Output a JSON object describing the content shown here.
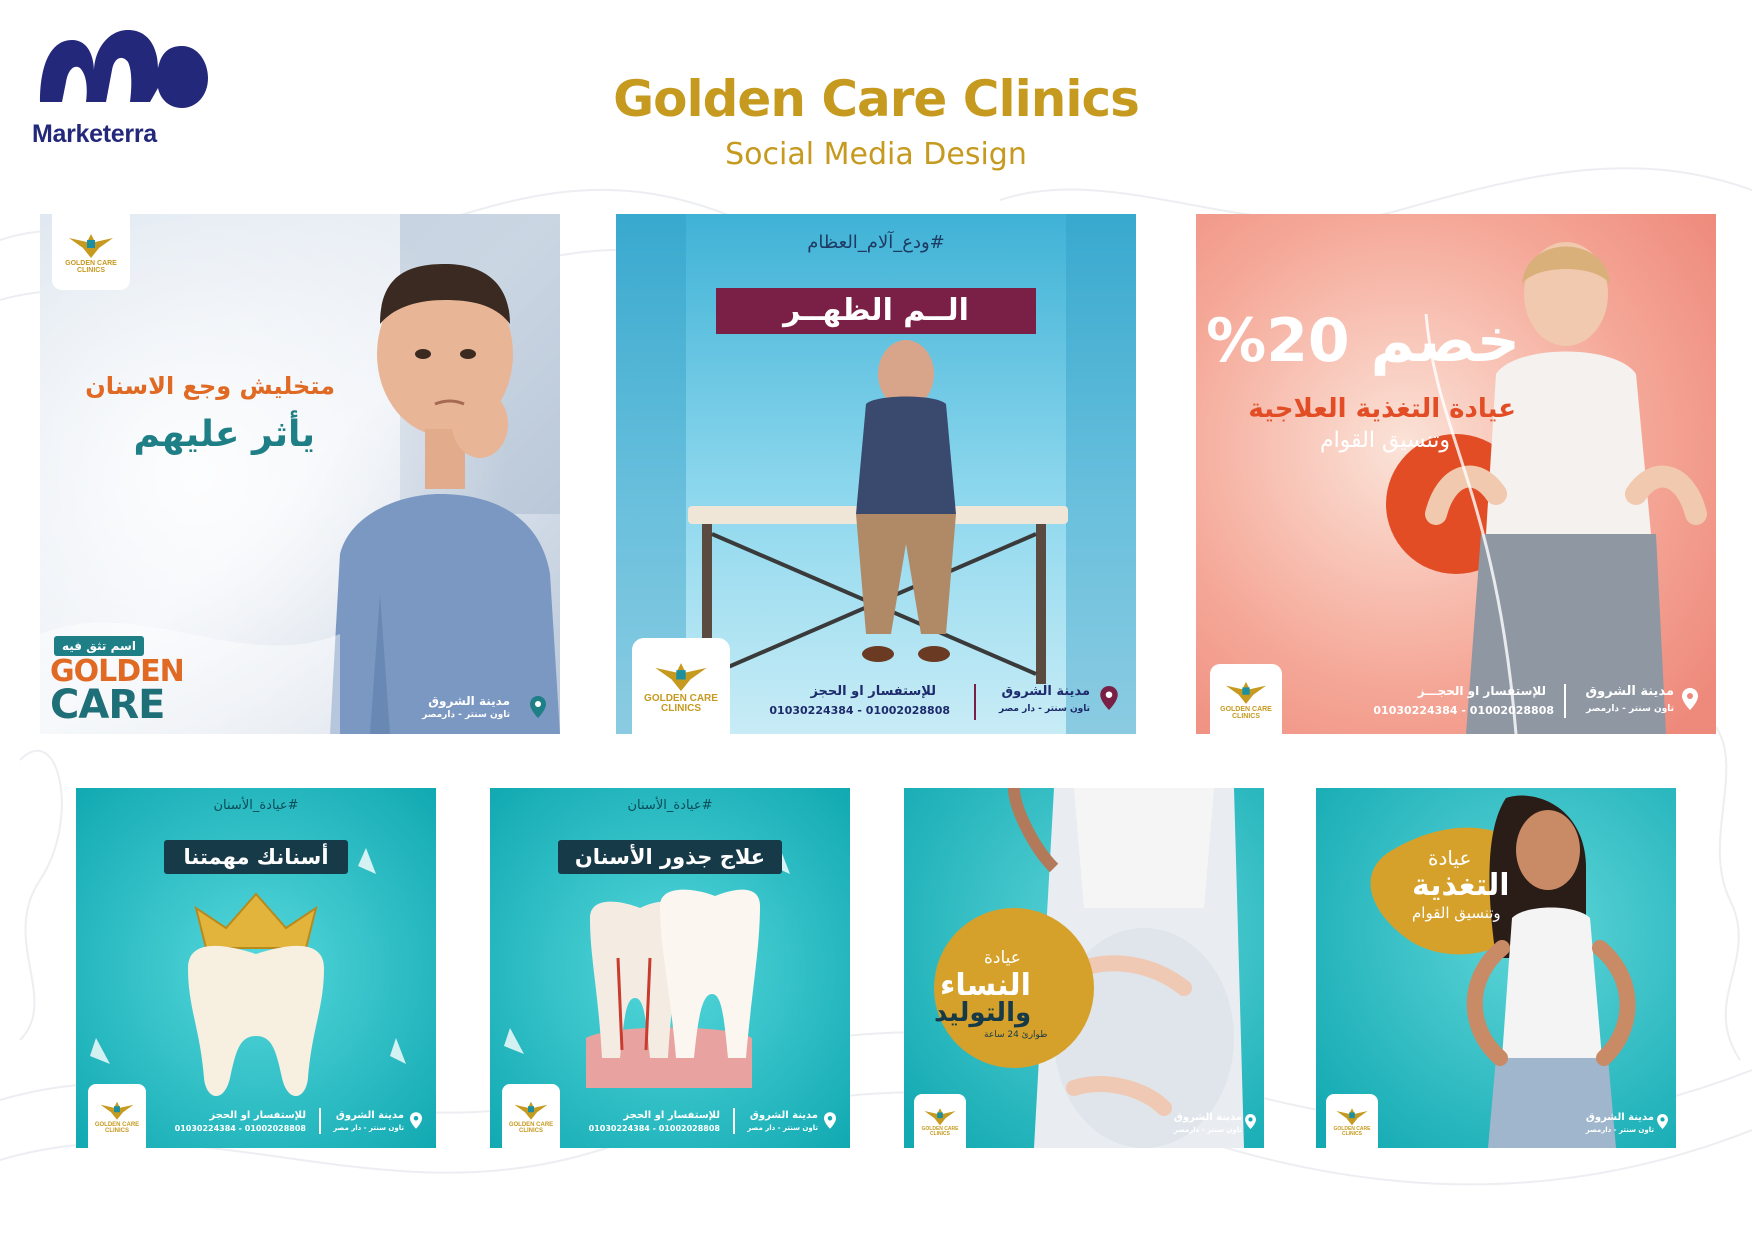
{
  "brand": {
    "name": "Marketerra"
  },
  "header": {
    "title": "Golden Care Clinics",
    "subtitle": "Social Media Design"
  },
  "clinic_logo": {
    "text": "GOLDEN CARE CLINICS"
  },
  "colors": {
    "gold": "#c69a1f",
    "navy": "#23287a",
    "teal": "#19b5bd",
    "maroon": "#7a1f45",
    "coral": "#f2978a"
  },
  "posts": [
    {
      "id": "dental-kids",
      "headline_line1": "متخليش وجع الاسنان",
      "headline_line2": "يأثر عليهم",
      "tagline": "اسم تثق فيه",
      "wordmark_1": "GOLDEN",
      "wordmark_2": "CARE",
      "location": "مدينة الشروق",
      "location_sub": "تاون سنتر - دارمصر"
    },
    {
      "id": "back-pain",
      "hashtag": "#ودع_آلام_العظام",
      "headline": "الــم الظهــر",
      "contact_label": "للإستفسار او الحجز",
      "phones": "01030224384 - 01002028808",
      "location": "مدينة الشروق",
      "location_sub": "تاون سنتر - دار مصر"
    },
    {
      "id": "nutrition-discount",
      "discount": "خصم 20%",
      "line1": "عيادة التغذية العلاجية",
      "line2": "وتنسيق القوام",
      "contact_label": "للإستفسار او الحجـــز",
      "phones": "01030224384 - 01002028808",
      "location": "مدينة الشروق",
      "location_sub": "تاون سنتر - دارمصر"
    },
    {
      "id": "teeth-mission",
      "hashtag": "#عيادة_الأسنان",
      "headline": "أسنانك مهمتنا",
      "contact_label": "للإستفسار او الحجز",
      "phones": "01030224384 - 01002028808",
      "location": "مدينة الشروق",
      "location_sub": "تاون سنتر - دار مصر"
    },
    {
      "id": "root-canal",
      "hashtag": "#عيادة_الأسنان",
      "headline": "علاج جذور الأسنان",
      "contact_label": "للإستفسار او الحجز",
      "phones": "01030224384 - 01002028808",
      "location": "مدينة الشروق",
      "location_sub": "تاون سنتر - دار مصر"
    },
    {
      "id": "obgyn",
      "line1": "عيادة",
      "line2": "النساء",
      "line3": "والتوليد",
      "line4": "طوارئ 24 ساعة",
      "location": "مدينة الشروق",
      "location_sub": "تاون سنتر - دارمصر"
    },
    {
      "id": "nutrition",
      "line1": "عيادة",
      "line2": "التغذية",
      "line3": "وتنسيق القوام",
      "location": "مدينة الشروق",
      "location_sub": "تاون سنتر - دارمصر"
    }
  ]
}
